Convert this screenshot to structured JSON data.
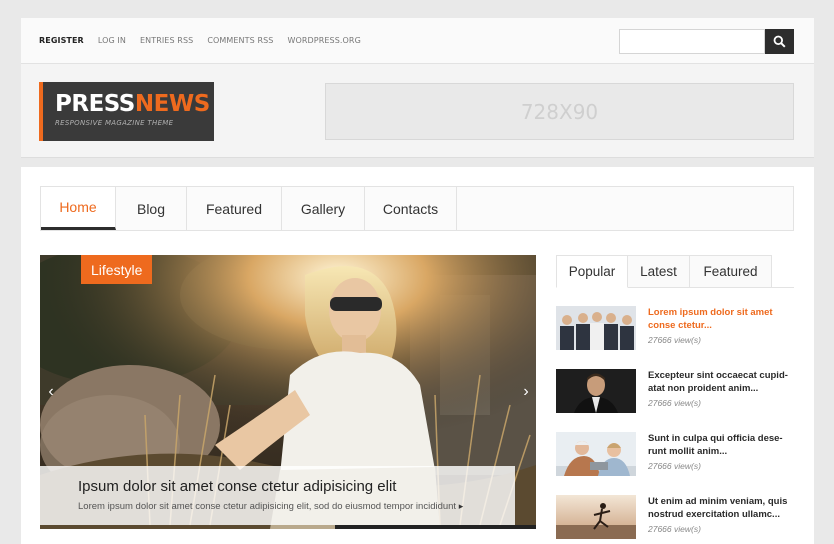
{
  "toplinks": [
    "REGISTER",
    "LOG IN",
    "ENTRIES RSS",
    "COMMENTS RSS",
    "WORDPRESS.ORG"
  ],
  "search": {
    "placeholder": "",
    "icon": "search-icon"
  },
  "logo": {
    "part1": "PRESS",
    "part2": "NEWS",
    "tagline": "RESPONSIVE MAGAZINE THEME"
  },
  "ad": {
    "label": "728X90"
  },
  "nav": [
    "Home",
    "Blog",
    "Featured",
    "Gallery",
    "Contacts"
  ],
  "slider": {
    "category": "Lifestyle",
    "title": "Ipsum dolor sit amet conse ctetur adipisicing elit",
    "excerpt": "Lorem ipsum dolor sit amet conse ctetur adipisicing elit, sod do eiusmod tempor incididunt",
    "more": "▸",
    "prev": "‹",
    "next": "›"
  },
  "sidebar": {
    "tabs": [
      "Popular",
      "Latest",
      "Featured"
    ],
    "posts": [
      {
        "title": "Lorem ipsum dolor sit amet conse ctetur...",
        "views": "27666 view(s)"
      },
      {
        "title": "Excepteur sint occaecat cupid-atat non proident anim...",
        "views": "27666 view(s)"
      },
      {
        "title": "Sunt in culpa qui officia dese-runt mollit anim...",
        "views": "27666 view(s)"
      },
      {
        "title": "Ut enim ad minim veniam, quis nostrud exercitation ullamc...",
        "views": "27666 view(s)"
      }
    ]
  },
  "colors": {
    "accent": "#ee6a1e",
    "dark": "#2d2d2d"
  }
}
